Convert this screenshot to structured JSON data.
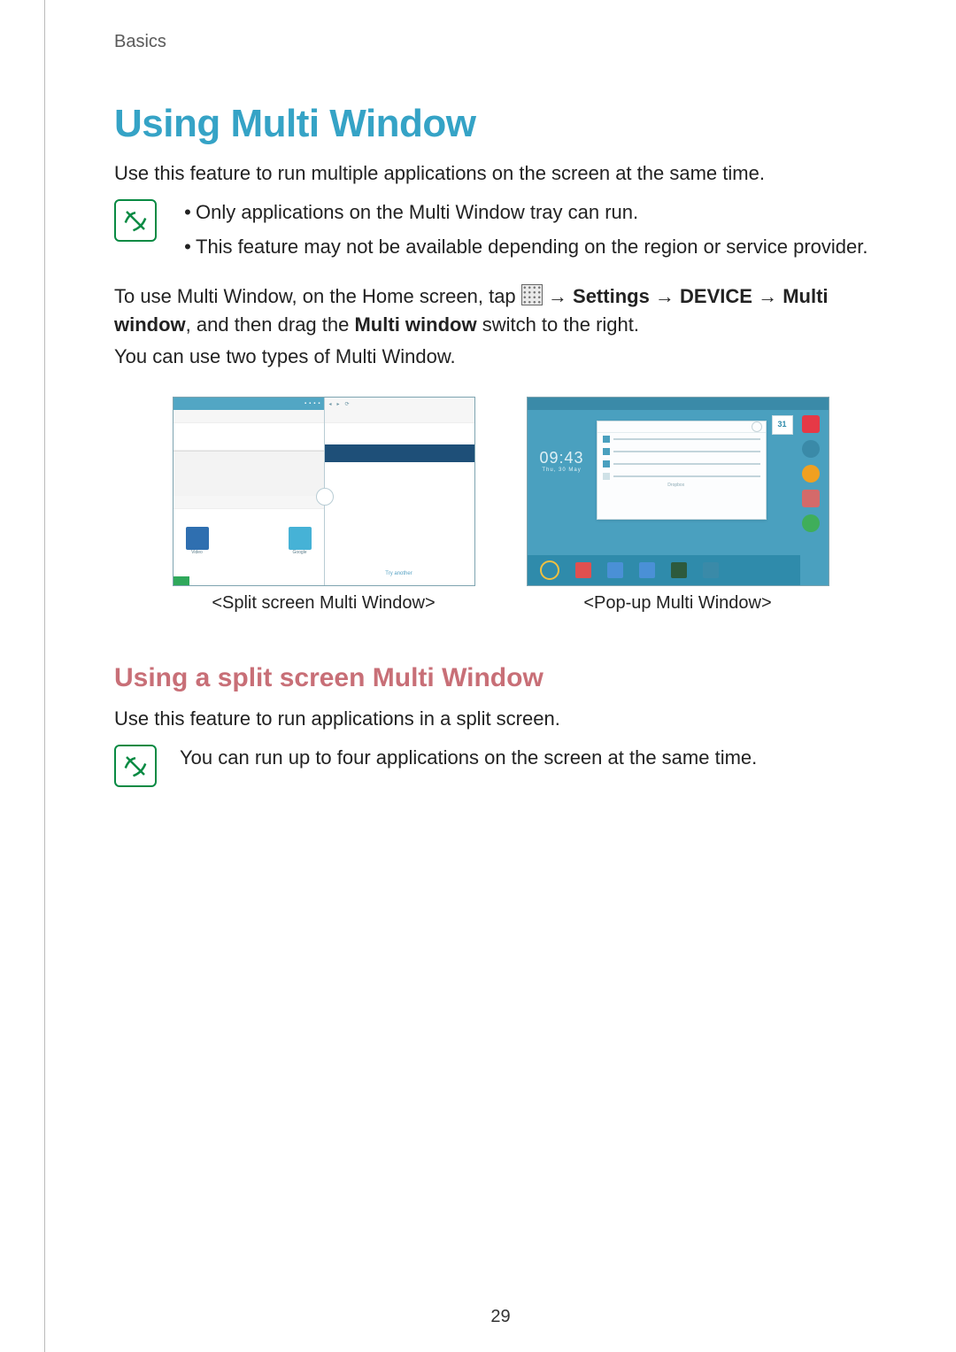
{
  "breadcrumb": "Basics",
  "title": "Using Multi Window",
  "intro": "Use this feature to run multiple applications on the screen at the same time.",
  "note1": {
    "items": [
      "Only applications on the Multi Window tray can run.",
      "This feature may not be available depending on the region or service provider."
    ]
  },
  "instruction": {
    "prefix": "To use Multi Window, on the Home screen, tap ",
    "arrow": " → ",
    "path": [
      "Settings",
      "DEVICE",
      "Multi window"
    ],
    "suffix": ", and then drag the ",
    "switch_label": "Multi window",
    "suffix2": " switch to the right."
  },
  "types_line": "You can use two types of Multi Window.",
  "figures": {
    "split_caption": "<Split screen Multi Window>",
    "popup_caption": "<Pop-up Multi Window>",
    "clock_time": "09:43",
    "clock_date": "Thu, 30 May",
    "cal_day": "31",
    "popup_tag": "Dropbox"
  },
  "subheading": "Using a split screen Multi Window",
  "sub_intro": "Use this feature to run applications in a split screen.",
  "note2": "You can run up to four applications on the screen at the same time.",
  "page_number": "29"
}
